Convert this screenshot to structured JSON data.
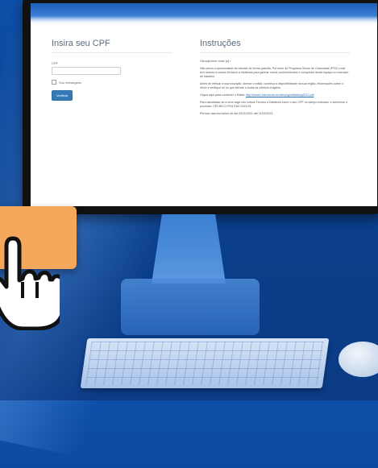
{
  "left_panel": {
    "title": "Insira seu CPF",
    "cpf_label": "CPF",
    "cpf_value": "",
    "foreigner_label": "Sou estrangeiro",
    "submit_label": "Verificar"
  },
  "instructions": {
    "title": "Instruções",
    "paragraphs": [
      "Olá seja bem vindo (a) !",
      "Não perca a oportunidade de estudar de forma gratuita. Por meio do Programa Senac de Gratuidade (PSG) você tem acesso a cursos técnicos a distância para ganhar novos conhecimentos e conquistar ainda espaço no mercado de trabalho.",
      "Antes de efetuar a sua inscrição, acesse o edital, conheça a disponibilidade na sua região, informações sobre o ofício e verifique se os que atende a todas as critérios exigidos.",
      "Clique aqui para conhecer o Edital: http://www2.ead.senac.br/cdn/psg/edital/psg2021.pdf",
      "Para candidatar-se a uma vaga nos cursos Técnico a Distância escre o seu CPF no campo indicado, e selecione o processo: TÉCNICO PSG EAD 2021/01.",
      "Período das inscrições de dia 03/11/2021 até 11/02/2021."
    ],
    "link_prefix": "Clique aqui para conhecer o Edital: ",
    "link_text": "http://www2.ead.senac.br/cdn/psg/edital/psg2021.pdf"
  },
  "colors": {
    "background": "#0d4fa8",
    "button": "#337ab7",
    "card": "#f5a75c"
  },
  "icons": [
    "hand-pointer-cursor-icon"
  ]
}
